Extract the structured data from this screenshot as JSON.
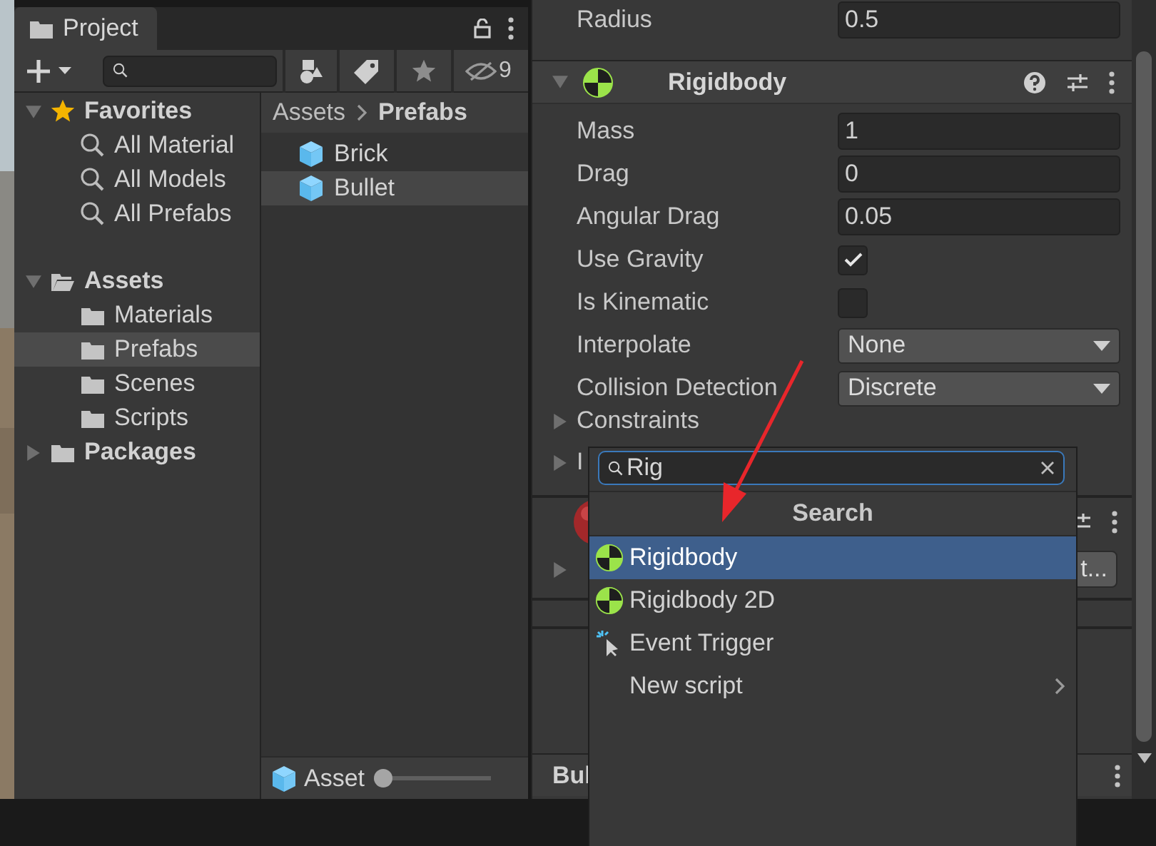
{
  "project": {
    "tab": "Project",
    "hidden_count": "9",
    "tree": [
      {
        "label": "Favorites",
        "kind": "favorites",
        "expanded": true,
        "selected": false,
        "children": [
          {
            "label": "All Material",
            "kind": "search",
            "selected": false
          },
          {
            "label": "All Models",
            "kind": "search",
            "selected": false
          },
          {
            "label": "All Prefabs",
            "kind": "search",
            "selected": false
          }
        ]
      },
      {
        "label": "Assets",
        "kind": "folder",
        "expanded": true,
        "selected": false,
        "children": [
          {
            "label": "Materials",
            "kind": "folder",
            "selected": false
          },
          {
            "label": "Prefabs",
            "kind": "folder",
            "selected": true
          },
          {
            "label": "Scenes",
            "kind": "folder",
            "selected": false
          },
          {
            "label": "Scripts",
            "kind": "folder",
            "selected": false
          }
        ]
      },
      {
        "label": "Packages",
        "kind": "folder",
        "expanded": false,
        "selected": false
      }
    ],
    "breadcrumb": [
      "Assets",
      "Prefabs"
    ],
    "assets": [
      {
        "name": "Brick",
        "selected": false
      },
      {
        "name": "Bullet",
        "selected": true
      }
    ],
    "footer": {
      "label": "Asset",
      "level": 0
    }
  },
  "inspector": {
    "top_field": {
      "label": "Radius",
      "value": "0.5"
    },
    "component": {
      "title": "Rigidbody",
      "expanded": true,
      "fields": [
        {
          "kind": "number",
          "label": "Mass",
          "value": "1"
        },
        {
          "kind": "number",
          "label": "Drag",
          "value": "0"
        },
        {
          "kind": "number",
          "label": "Angular Drag",
          "value": "0.05"
        },
        {
          "kind": "checkbox",
          "label": "Use Gravity",
          "checked": true
        },
        {
          "kind": "checkbox",
          "label": "Is Kinematic",
          "checked": false
        },
        {
          "kind": "dropdown",
          "label": "Interpolate",
          "value": "None"
        },
        {
          "kind": "dropdown",
          "label": "Collision Detection",
          "value": "Discrete"
        }
      ],
      "foldouts": [
        {
          "label": "Constraints",
          "expanded": false
        },
        {
          "label": "I",
          "expanded": false
        }
      ]
    },
    "next_component_button": "t...",
    "bottom_bar": {
      "title": "Bul"
    }
  },
  "add_component_popup": {
    "search": {
      "value": "Rig"
    },
    "header": "Search",
    "items": [
      {
        "kind": "rigidbody",
        "label": "Rigidbody",
        "selected": true
      },
      {
        "kind": "rigidbody",
        "label": "Rigidbody 2D",
        "selected": false
      },
      {
        "kind": "event",
        "label": "Event Trigger",
        "selected": false
      },
      {
        "kind": "submenu",
        "label": "New script",
        "selected": false
      }
    ]
  }
}
